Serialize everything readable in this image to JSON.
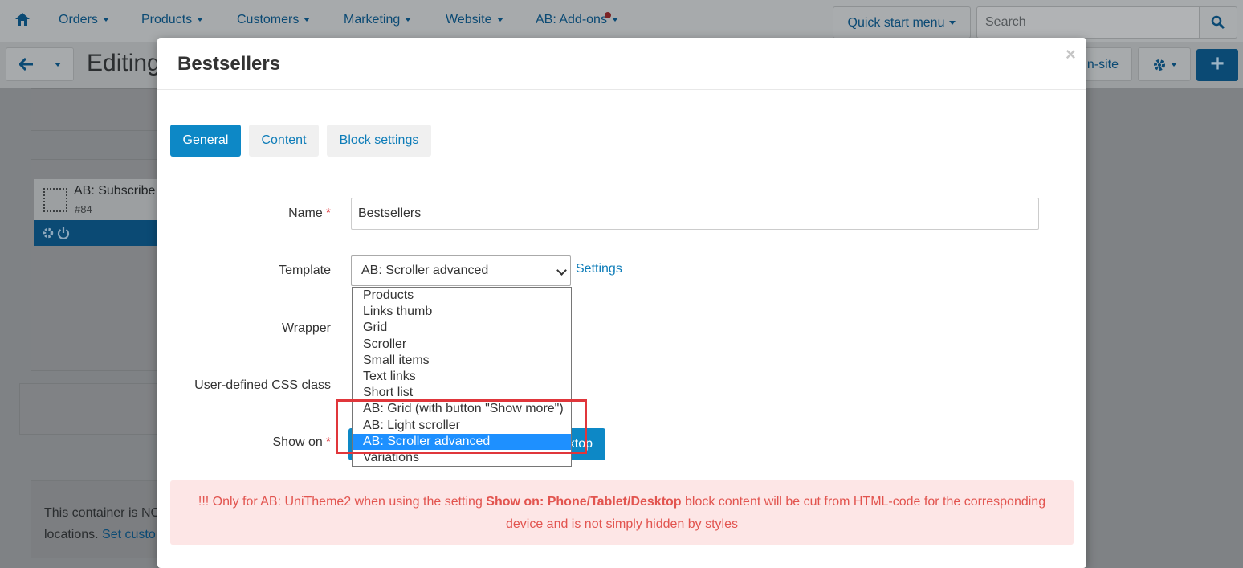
{
  "topnav": {
    "home_icon": "home-icon",
    "items": [
      {
        "label": "Orders"
      },
      {
        "label": "Products"
      },
      {
        "label": "Customers"
      },
      {
        "label": "Marketing"
      },
      {
        "label": "Website"
      },
      {
        "label": "AB: Add-ons"
      }
    ],
    "quick_start": "Quick start menu",
    "search_placeholder": "Search"
  },
  "subheader": {
    "title": "Editing",
    "onsite_label": "n-site",
    "plus_label": "+"
  },
  "background": {
    "block_name": "AB: Subscribe",
    "block_id": "#84",
    "notice_line1": "This container is NO",
    "notice_line2_text": "locations.",
    "notice_link": "Set custo"
  },
  "modal": {
    "title": "Bestsellers",
    "close_label": "×",
    "tabs": [
      {
        "label": "General",
        "active": true
      },
      {
        "label": "Content",
        "active": false
      },
      {
        "label": "Block settings",
        "active": false
      }
    ],
    "fields": {
      "name_label": "Name",
      "name_value": "Bestsellers",
      "template_label": "Template",
      "template_value": "AB: Scroller advanced",
      "settings_link": "Settings",
      "wrapper_label": "Wrapper",
      "css_label": "User-defined CSS class",
      "show_on_label": "Show on",
      "device_button_tail": "ktop"
    },
    "template_options": [
      "Products",
      "Links thumb",
      "Grid",
      "Scroller",
      "Small items",
      "Text links",
      "Short list",
      "AB: Grid (with button \"Show more\")",
      "AB: Light scroller",
      "AB: Scroller advanced",
      "Variations"
    ],
    "template_selected_index": 9,
    "alert": {
      "prefix": "!!! Only for AB: UniTheme2 when using the setting ",
      "bold": "Show on: Phone/Tablet/Desktop",
      "suffix": " block content will be cut from HTML-code for the corresponding device and is not simply hidden by styles"
    }
  },
  "colors": {
    "accent": "#0d88c6",
    "highlight": "#e0363b",
    "selected_option": "#1e90ff"
  }
}
